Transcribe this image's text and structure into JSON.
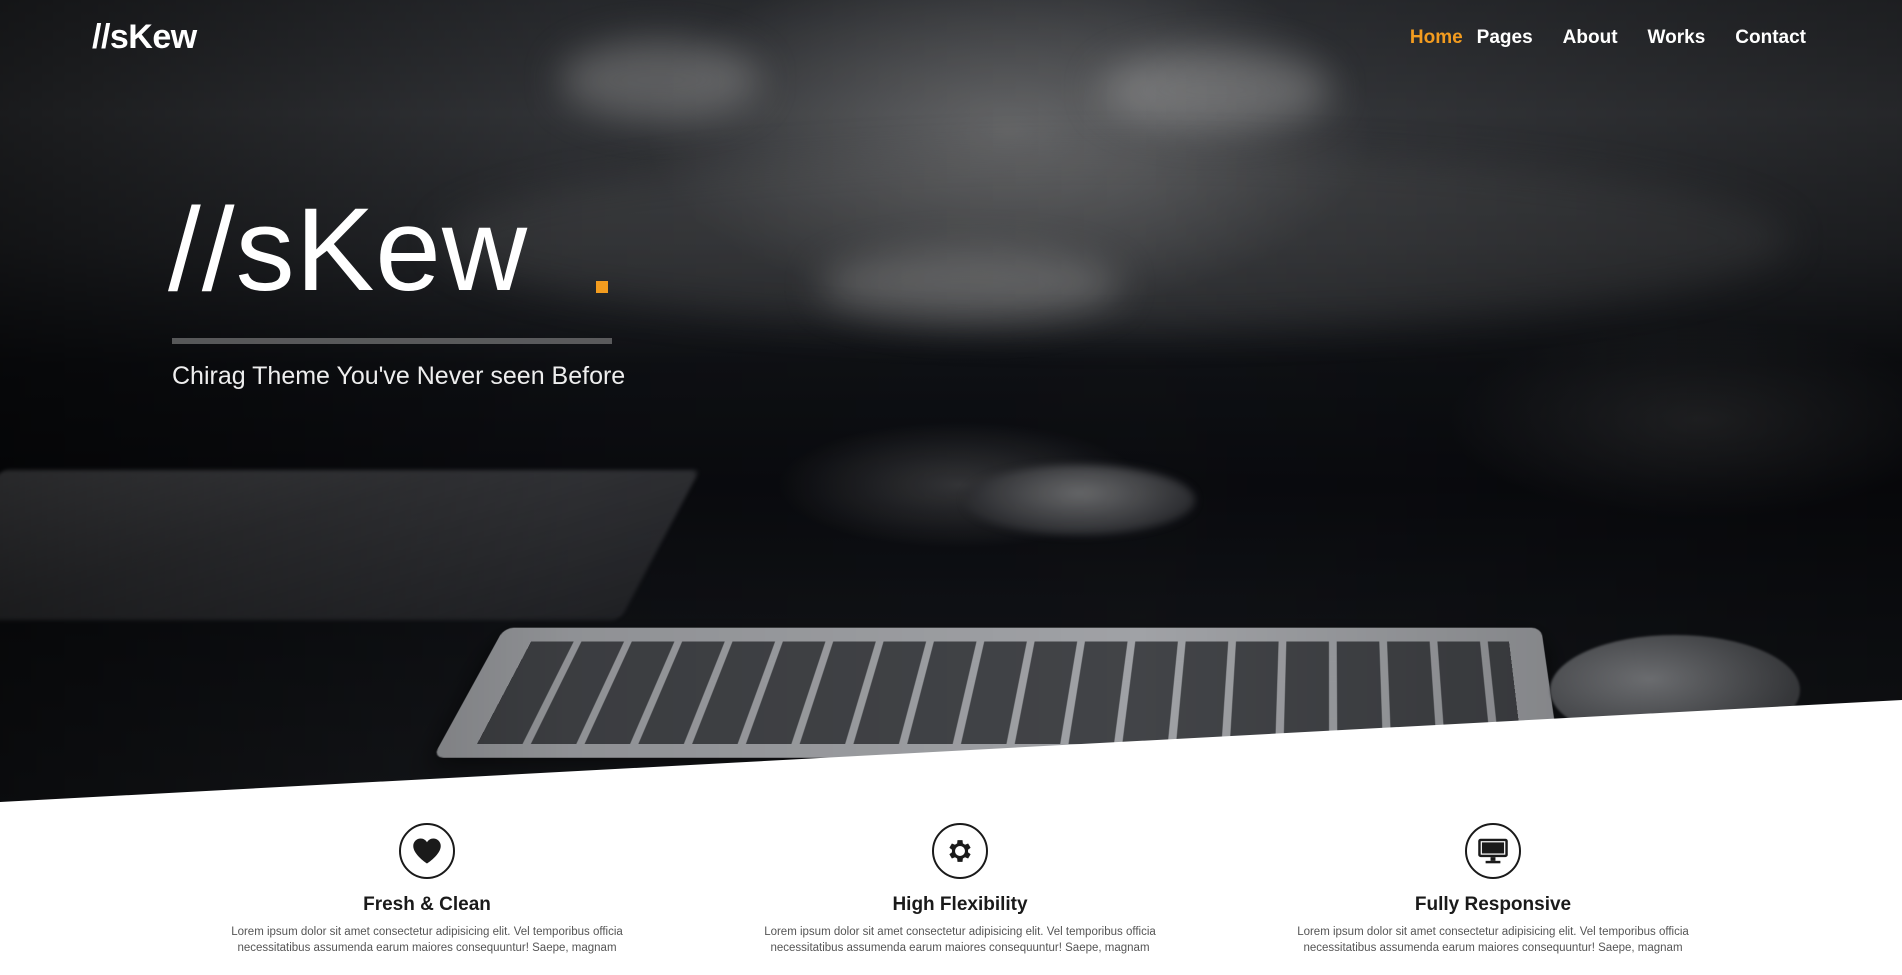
{
  "brand": {
    "logo": "//sKew",
    "accent_color": "#f39c1f"
  },
  "nav": {
    "items": [
      {
        "label": "Home",
        "active": true
      },
      {
        "label": "Pages",
        "active": false
      },
      {
        "label": "About",
        "active": false
      },
      {
        "label": "Works",
        "active": false
      },
      {
        "label": "Contact",
        "active": false
      }
    ]
  },
  "hero": {
    "title": "//sKew",
    "tagline": "Chirag Theme You've Never seen Before"
  },
  "features": [
    {
      "icon": "heart-icon",
      "title": "Fresh & Clean",
      "text": "Lorem ipsum dolor sit amet consectetur adipisicing elit. Vel temporibus officia necessitatibus assumenda earum maiores consequuntur! Saepe, magnam"
    },
    {
      "icon": "gear-icon",
      "title": "High Flexibility",
      "text": "Lorem ipsum dolor sit amet consectetur adipisicing elit. Vel temporibus officia necessitatibus assumenda earum maiores consequuntur! Saepe, magnam"
    },
    {
      "icon": "monitor-icon",
      "title": "Fully Responsive",
      "text": "Lorem ipsum dolor sit amet consectetur adipisicing elit. Vel temporibus officia necessitatibus assumenda earum maiores consequuntur! Saepe, magnam"
    }
  ]
}
